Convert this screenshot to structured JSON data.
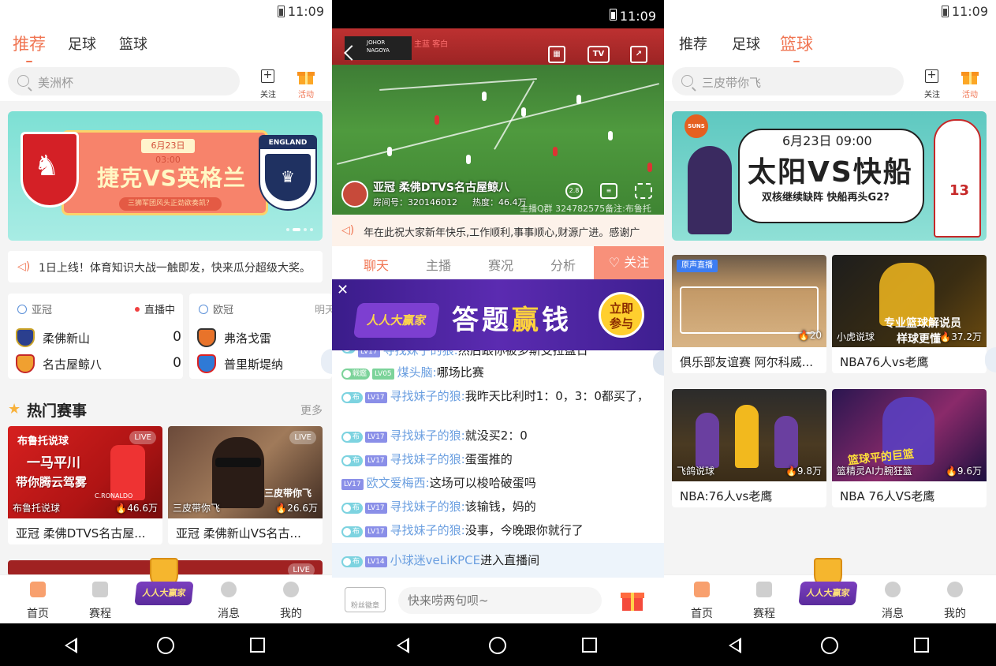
{
  "status": {
    "time": "11:09"
  },
  "screen1": {
    "tabs": [
      "推荐",
      "足球",
      "篮球"
    ],
    "search_placeholder": "美洲杯",
    "follow_label": "关注",
    "activity_label": "活动",
    "banner": {
      "date": "6月23日 03:00",
      "title": "捷克VS英格兰",
      "sub": "三狮军团风头正劲欲奏凯？",
      "england_text": "ENGLAND"
    },
    "notice": "1日上线！体育知识大战一触即发，快来瓜分超级大奖。",
    "matches": [
      {
        "league": "亚冠",
        "status": "直播中",
        "home": "柔佛新山",
        "away": "名古屋鲸八",
        "home_score": "0",
        "away_score": "0"
      },
      {
        "league": "欧冠",
        "status": "明天",
        "home": "弗洛戈雷",
        "away": "普里斯堤纳"
      }
    ],
    "section_title": "热门赛事",
    "more": "更多",
    "cards": [
      {
        "thumb_text": "布鲁托说球",
        "thumb_line1": "一马平川",
        "thumb_line2": "带你腾云驾雾",
        "player_name": "C.RONALDO",
        "live": "LIVE",
        "anchor": "布鲁托说球",
        "heat": "46.6万",
        "title": "亚冠 柔佛DTVS名古屋..."
      },
      {
        "live": "LIVE",
        "anchor": "三皮带你飞",
        "overlay": "三皮带你飞",
        "heat": "26.6万",
        "title": "亚冠 柔佛新山VS名古..."
      }
    ],
    "third_card_live": "LIVE"
  },
  "bottomnav": {
    "home": "首页",
    "schedule": "赛程",
    "mascot": "人人大赢家",
    "messages": "消息",
    "mine": "我的"
  },
  "screen2": {
    "score_home": "JOHOR",
    "score_away": "NAGOYA",
    "score_tag": "主蓝 客白",
    "tv_label": "TV",
    "room_title": "亚冠 柔佛DTVS名古屋鲸八",
    "room_id": "房间号：320146012",
    "heat": "热度：46.4万",
    "watermark": "主播Q群 324782575备注:布鲁托",
    "bitrate_label": "2.8",
    "announcement": "年在此祝大家新年快乐,工作顺利,事事顺心,财源广进。感谢广",
    "tabs": [
      "聊天",
      "主播",
      "赛况",
      "分析"
    ],
    "follow": "关注",
    "promo": {
      "logo": "人人大赢家",
      "text1": "答题",
      "text2": "赢",
      "text3": "钱",
      "join_line1": "立即",
      "join_line2": "参与"
    },
    "messages": [
      {
        "badge": "",
        "lv": "LV17",
        "name": "寻找妹子的狼:",
        "text": "然后跟你被多斯支拉盘日"
      },
      {
        "badge": "戦鑑",
        "lv": "LV05",
        "name": "煤头脑:",
        "text": "哪场比赛"
      },
      {
        "badge": "布",
        "lv": "LV17",
        "name": "寻找妹子的狼:",
        "text": "我昨天比利时1：0，3：0都买了，"
      },
      {
        "badge": "布",
        "lv": "LV17",
        "name": "寻找妹子的狼:",
        "text": "就没买2：0"
      },
      {
        "badge": "布",
        "lv": "LV17",
        "name": "寻找妹子的狼:",
        "text": "蛋蛋推的"
      },
      {
        "badge": "",
        "lv": "LV17",
        "name": "欧文爱梅西:",
        "text": "这场可以梭哈破蛋吗"
      },
      {
        "badge": "布",
        "lv": "LV17",
        "name": "寻找妹子的狼:",
        "text": "该输钱，妈的"
      },
      {
        "badge": "布",
        "lv": "LV17",
        "name": "寻找妹子的狼:",
        "text": "没事，今晚跟你就行了"
      }
    ],
    "enter": {
      "badge": "布",
      "lv": "LV14",
      "name": "小球迷veLiKPCE",
      "text": "进入直播间"
    },
    "fans_badge": "粉丝徽章",
    "input_placeholder": "快来唠两句呗~"
  },
  "screen3": {
    "tabs": [
      "推荐",
      "足球",
      "篮球"
    ],
    "search_placeholder": "三皮带你飞",
    "follow_label": "关注",
    "activity_label": "活动",
    "banner": {
      "date": "6月23日 09:00",
      "title": "太阳VS快船",
      "sub": "双核继续缺阵 快船再头G2?",
      "suns": "SUNS",
      "jersey": "13"
    },
    "cards": [
      {
        "tag": "原声直播",
        "anchor": "",
        "heat": "20",
        "title": "俱乐部友谊赛 阿尔科威..."
      },
      {
        "anchor": "小虎说球",
        "overlay": "专业篮球解说员",
        "overlay2": "样球更懂",
        "heat": "37.2万",
        "title": "NBA76人vs老鹰"
      },
      {
        "anchor": "飞鸽说球",
        "heat": "9.8万",
        "title": "NBA:76人vs老鹰"
      },
      {
        "anchor": "篮精灵AI力腕狂篮",
        "overlay": "篮球平的巨篮",
        "heat": "9.6万",
        "title": "NBA 76人VS老鹰"
      }
    ]
  }
}
